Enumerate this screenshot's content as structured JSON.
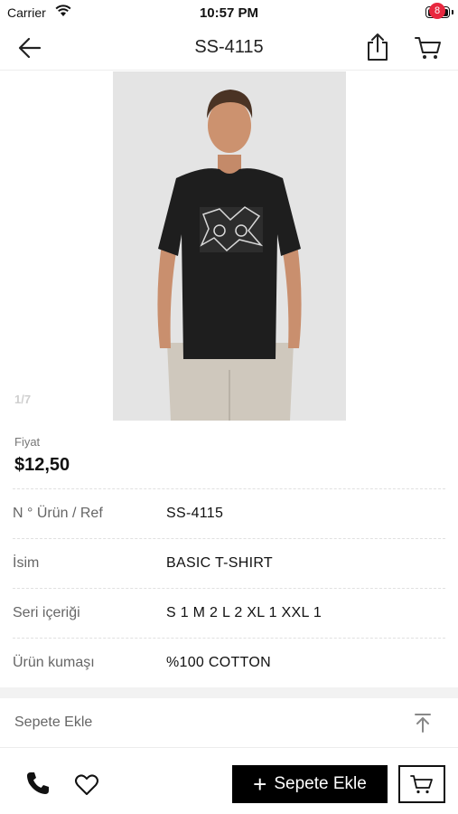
{
  "status_bar": {
    "carrier": "Carrier",
    "time": "10:57 PM"
  },
  "nav": {
    "title": "SS-4115",
    "cart_count": "8"
  },
  "gallery": {
    "page_indicator": "1/7",
    "image": "product-photo-man-black-tshirt"
  },
  "price": {
    "label": "Fiyat",
    "value": "$12,50"
  },
  "attributes": [
    {
      "label": "N ° Ürün / Ref",
      "value": "SS-4115"
    },
    {
      "label": "İsim",
      "value": "BASIC T-SHIRT"
    },
    {
      "label": "Seri içeriği",
      "value": "S 1 M 2 L 2 XL 1 XXL 1"
    },
    {
      "label": "Ürün kumaşı",
      "value": "%100 COTTON"
    }
  ],
  "add_section": {
    "label": "Sepete Ekle"
  },
  "bottom_bar": {
    "add_to_cart_label": "Sepete Ekle"
  },
  "icons": {
    "back": "back-arrow-icon",
    "share": "share-icon",
    "cart": "cart-icon",
    "scroll_top": "scroll-top-icon",
    "phone": "phone-icon",
    "favorite": "heart-icon"
  },
  "colors": {
    "accent": "#000000",
    "badge": "#e8283f",
    "photo_bg": "#e4e4e4"
  }
}
